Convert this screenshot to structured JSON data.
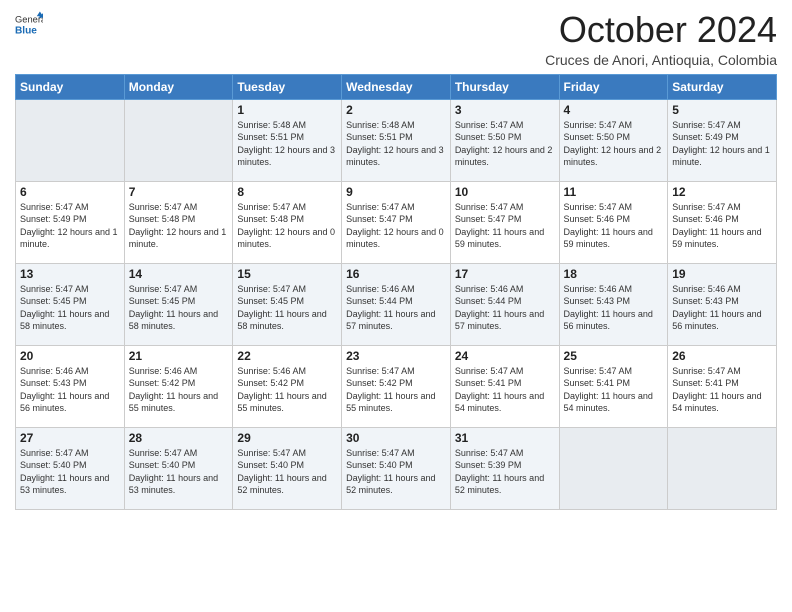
{
  "logo": {
    "general": "General",
    "blue": "Blue"
  },
  "header": {
    "month": "October 2024",
    "location": "Cruces de Anori, Antioquia, Colombia"
  },
  "weekdays": [
    "Sunday",
    "Monday",
    "Tuesday",
    "Wednesday",
    "Thursday",
    "Friday",
    "Saturday"
  ],
  "weeks": [
    [
      {
        "day": "",
        "info": ""
      },
      {
        "day": "",
        "info": ""
      },
      {
        "day": "1",
        "info": "Sunrise: 5:48 AM\nSunset: 5:51 PM\nDaylight: 12 hours and 3 minutes."
      },
      {
        "day": "2",
        "info": "Sunrise: 5:48 AM\nSunset: 5:51 PM\nDaylight: 12 hours and 3 minutes."
      },
      {
        "day": "3",
        "info": "Sunrise: 5:47 AM\nSunset: 5:50 PM\nDaylight: 12 hours and 2 minutes."
      },
      {
        "day": "4",
        "info": "Sunrise: 5:47 AM\nSunset: 5:50 PM\nDaylight: 12 hours and 2 minutes."
      },
      {
        "day": "5",
        "info": "Sunrise: 5:47 AM\nSunset: 5:49 PM\nDaylight: 12 hours and 1 minute."
      }
    ],
    [
      {
        "day": "6",
        "info": "Sunrise: 5:47 AM\nSunset: 5:49 PM\nDaylight: 12 hours and 1 minute."
      },
      {
        "day": "7",
        "info": "Sunrise: 5:47 AM\nSunset: 5:48 PM\nDaylight: 12 hours and 1 minute."
      },
      {
        "day": "8",
        "info": "Sunrise: 5:47 AM\nSunset: 5:48 PM\nDaylight: 12 hours and 0 minutes."
      },
      {
        "day": "9",
        "info": "Sunrise: 5:47 AM\nSunset: 5:47 PM\nDaylight: 12 hours and 0 minutes."
      },
      {
        "day": "10",
        "info": "Sunrise: 5:47 AM\nSunset: 5:47 PM\nDaylight: 11 hours and 59 minutes."
      },
      {
        "day": "11",
        "info": "Sunrise: 5:47 AM\nSunset: 5:46 PM\nDaylight: 11 hours and 59 minutes."
      },
      {
        "day": "12",
        "info": "Sunrise: 5:47 AM\nSunset: 5:46 PM\nDaylight: 11 hours and 59 minutes."
      }
    ],
    [
      {
        "day": "13",
        "info": "Sunrise: 5:47 AM\nSunset: 5:45 PM\nDaylight: 11 hours and 58 minutes."
      },
      {
        "day": "14",
        "info": "Sunrise: 5:47 AM\nSunset: 5:45 PM\nDaylight: 11 hours and 58 minutes."
      },
      {
        "day": "15",
        "info": "Sunrise: 5:47 AM\nSunset: 5:45 PM\nDaylight: 11 hours and 58 minutes."
      },
      {
        "day": "16",
        "info": "Sunrise: 5:46 AM\nSunset: 5:44 PM\nDaylight: 11 hours and 57 minutes."
      },
      {
        "day": "17",
        "info": "Sunrise: 5:46 AM\nSunset: 5:44 PM\nDaylight: 11 hours and 57 minutes."
      },
      {
        "day": "18",
        "info": "Sunrise: 5:46 AM\nSunset: 5:43 PM\nDaylight: 11 hours and 56 minutes."
      },
      {
        "day": "19",
        "info": "Sunrise: 5:46 AM\nSunset: 5:43 PM\nDaylight: 11 hours and 56 minutes."
      }
    ],
    [
      {
        "day": "20",
        "info": "Sunrise: 5:46 AM\nSunset: 5:43 PM\nDaylight: 11 hours and 56 minutes."
      },
      {
        "day": "21",
        "info": "Sunrise: 5:46 AM\nSunset: 5:42 PM\nDaylight: 11 hours and 55 minutes."
      },
      {
        "day": "22",
        "info": "Sunrise: 5:46 AM\nSunset: 5:42 PM\nDaylight: 11 hours and 55 minutes."
      },
      {
        "day": "23",
        "info": "Sunrise: 5:47 AM\nSunset: 5:42 PM\nDaylight: 11 hours and 55 minutes."
      },
      {
        "day": "24",
        "info": "Sunrise: 5:47 AM\nSunset: 5:41 PM\nDaylight: 11 hours and 54 minutes."
      },
      {
        "day": "25",
        "info": "Sunrise: 5:47 AM\nSunset: 5:41 PM\nDaylight: 11 hours and 54 minutes."
      },
      {
        "day": "26",
        "info": "Sunrise: 5:47 AM\nSunset: 5:41 PM\nDaylight: 11 hours and 54 minutes."
      }
    ],
    [
      {
        "day": "27",
        "info": "Sunrise: 5:47 AM\nSunset: 5:40 PM\nDaylight: 11 hours and 53 minutes."
      },
      {
        "day": "28",
        "info": "Sunrise: 5:47 AM\nSunset: 5:40 PM\nDaylight: 11 hours and 53 minutes."
      },
      {
        "day": "29",
        "info": "Sunrise: 5:47 AM\nSunset: 5:40 PM\nDaylight: 11 hours and 52 minutes."
      },
      {
        "day": "30",
        "info": "Sunrise: 5:47 AM\nSunset: 5:40 PM\nDaylight: 11 hours and 52 minutes."
      },
      {
        "day": "31",
        "info": "Sunrise: 5:47 AM\nSunset: 5:39 PM\nDaylight: 11 hours and 52 minutes."
      },
      {
        "day": "",
        "info": ""
      },
      {
        "day": "",
        "info": ""
      }
    ]
  ]
}
